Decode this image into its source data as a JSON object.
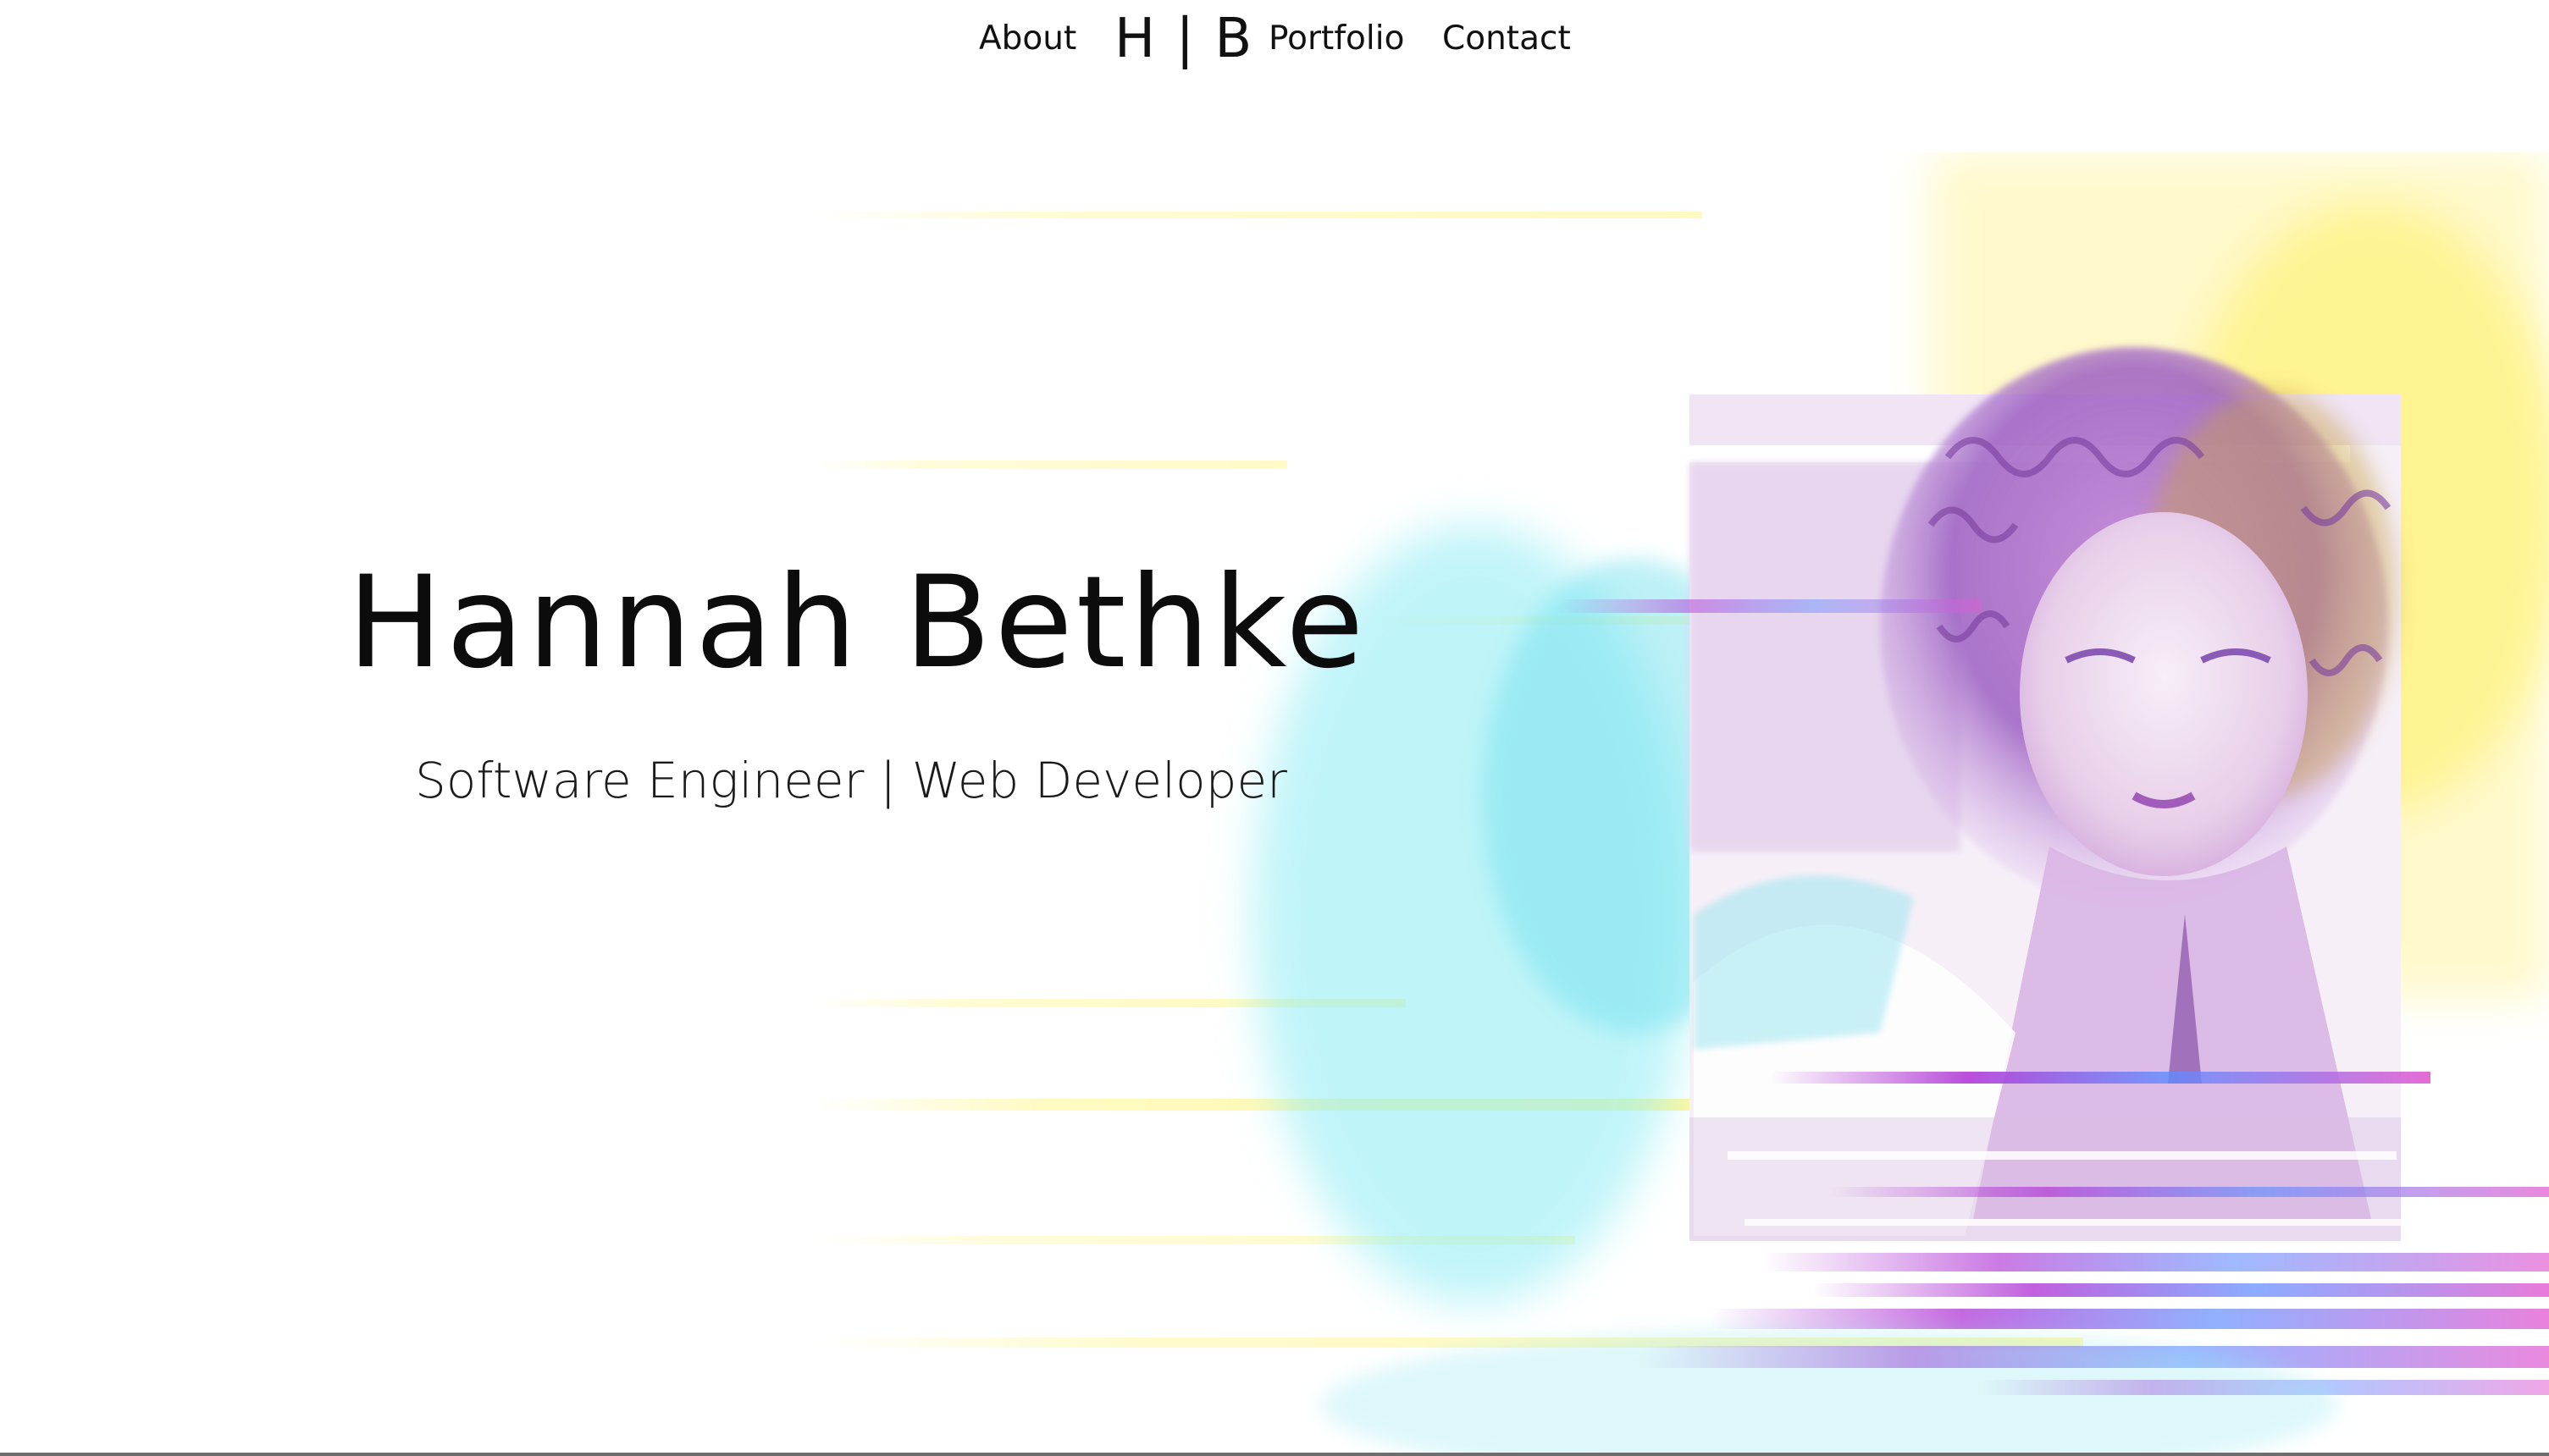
{
  "nav": {
    "about": "About",
    "logo": "H | B",
    "portfolio": "Portfolio",
    "contact": "Contact"
  },
  "hero": {
    "name": "Hannah Bethke",
    "role": "Software Engineer | Web Developer"
  },
  "portrait": {
    "alt": "Glitch-art portrait"
  },
  "colors": {
    "text": "#0c0c0c",
    "glitch_yellow": "#fff36a",
    "glitch_cyan": "#7ee8f2",
    "glitch_magenta": "#b23bd6",
    "glitch_purple": "#8a5bb6"
  }
}
